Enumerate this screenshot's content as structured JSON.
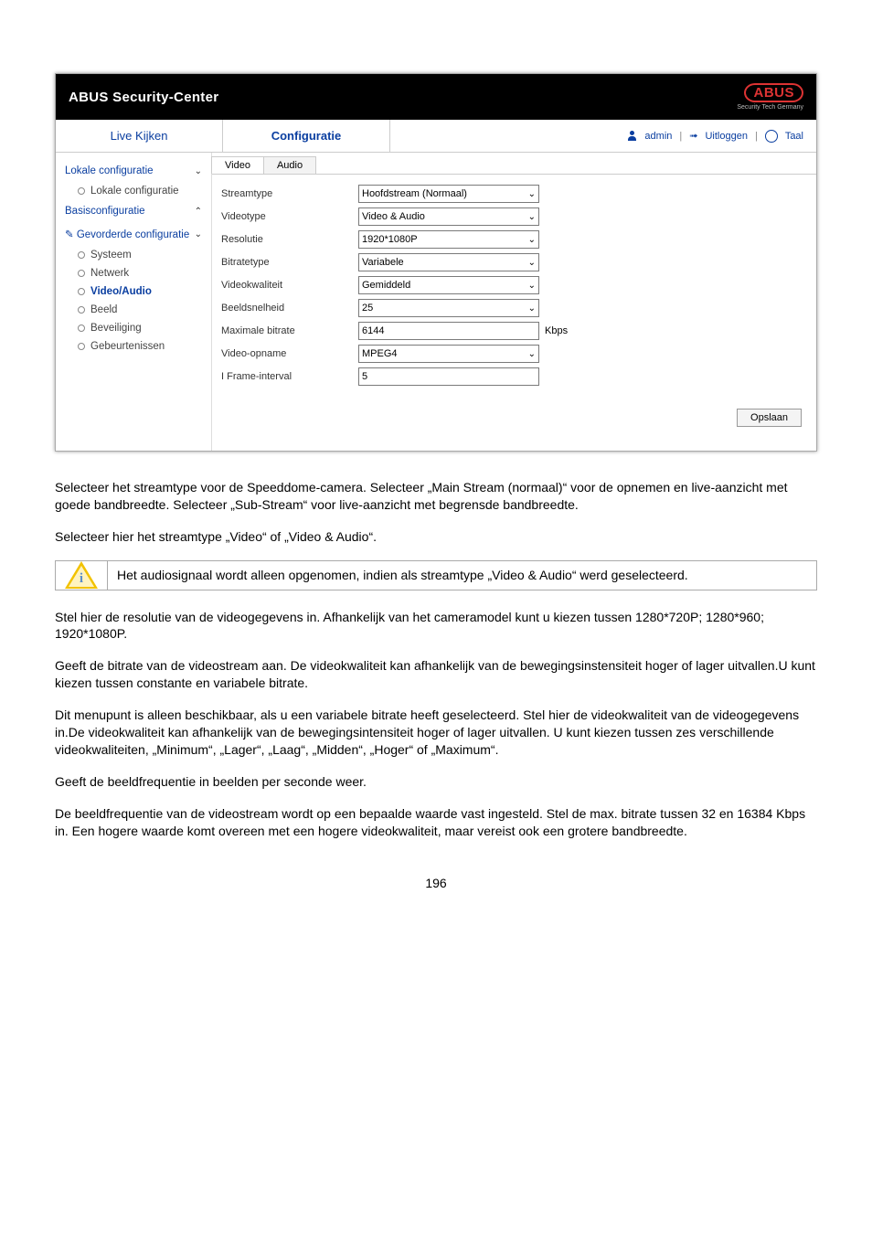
{
  "screenshot": {
    "header_title": "ABUS Security-Center",
    "logo_text": "ABUS",
    "logo_sub": "Security Tech Germany",
    "tabs": {
      "live": "Live Kijken",
      "config": "Configuratie"
    },
    "topright": {
      "admin": "admin",
      "logout": "Uitloggen",
      "lang": "Taal"
    },
    "sidebar": {
      "group_local": "Lokale configuratie",
      "item_local": "Lokale configuratie",
      "group_basic": "Basisconfiguratie",
      "group_advanced": "Gevorderde configuratie",
      "item_system": "Systeem",
      "item_network": "Netwerk",
      "item_videoaudio": "Video/Audio",
      "item_image": "Beeld",
      "item_security": "Beveiliging",
      "item_events": "Gebeurtenissen"
    },
    "subtabs": {
      "video": "Video",
      "audio": "Audio"
    },
    "form": {
      "streamtype_label": "Streamtype",
      "streamtype_value": "Hoofdstream (Normaal)",
      "videotype_label": "Videotype",
      "videotype_value": "Video & Audio",
      "resolution_label": "Resolutie",
      "resolution_value": "1920*1080P",
      "bitratetype_label": "Bitratetype",
      "bitratetype_value": "Variabele",
      "videoquality_label": "Videokwaliteit",
      "videoquality_value": "Gemiddeld",
      "framerate_label": "Beeldsnelheid",
      "framerate_value": "25",
      "maxbitrate_label": "Maximale bitrate",
      "maxbitrate_value": "6144",
      "maxbitrate_unit": "Kbps",
      "encoding_label": "Video-opname",
      "encoding_value": "MPEG4",
      "iframe_label": "I Frame-interval",
      "iframe_value": "5",
      "save": "Opslaan"
    }
  },
  "doc": {
    "p1": "Selecteer het streamtype voor de Speeddome-camera. Selecteer „Main Stream (normaal)“ voor de opnemen en live-aanzicht met goede bandbreedte. Selecteer „Sub-Stream“ voor live-aanzicht met begrensde bandbreedte.",
    "p2": "Selecteer hier het streamtype „Video“ of „Video & Audio“.",
    "note": "Het audiosignaal wordt alleen opgenomen, indien als streamtype „Video & Audio“ werd geselecteerd.",
    "p3": "Stel hier de resolutie van de videogegevens in. Afhankelijk van het cameramodel kunt u kiezen tussen 1280*720P; 1280*960; 1920*1080P.",
    "p4": "Geeft de bitrate van de videostream aan. De videokwaliteit kan afhankelijk van de bewegingsinstensiteit hoger of lager uitvallen.U kunt kiezen tussen constante en variabele bitrate.",
    "p5": "Dit menupunt is alleen beschikbaar, als u een variabele bitrate heeft geselecteerd. Stel hier de videokwaliteit van de videogegevens in.De videokwaliteit kan afhankelijk van de bewegingsintensiteit hoger of lager uitvallen. U kunt kiezen tussen zes verschillende videokwaliteiten, „Minimum“, „Lager“, „Laag“, „Midden“, „Hoger“ of „Maximum“.",
    "p6": "Geeft de beeldfrequentie in beelden per seconde weer.",
    "p7": "De beeldfrequentie van de videostream wordt op een bepaalde waarde vast ingesteld. Stel de max. bitrate tussen 32 en 16384 Kbps in. Een hogere waarde komt overeen met een hogere videokwaliteit, maar vereist ook een grotere bandbreedte.",
    "page_number": "196"
  }
}
